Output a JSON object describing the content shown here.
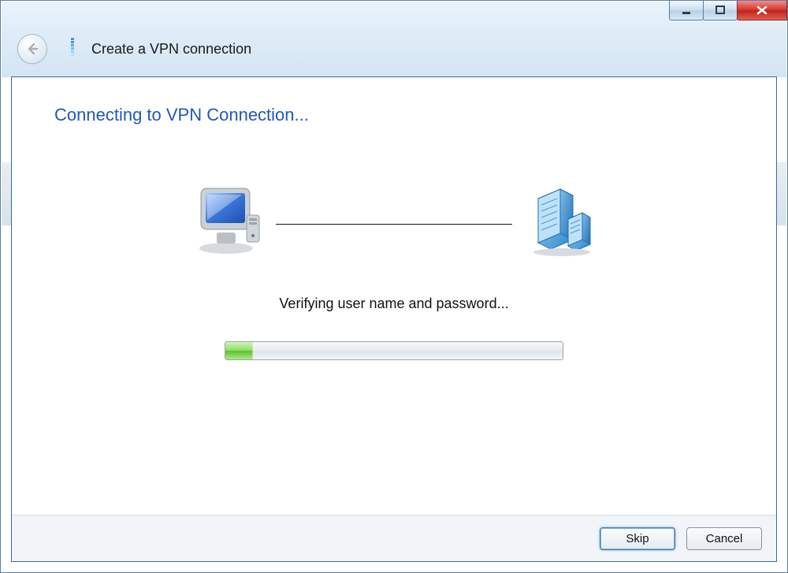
{
  "window": {
    "title": "Create a VPN connection"
  },
  "page": {
    "heading": "Connecting to VPN Connection...",
    "status": "Verifying user name and password...",
    "progress_percent": 8
  },
  "buttons": {
    "skip": "Skip",
    "cancel": "Cancel"
  },
  "controls": {
    "minimize": "Minimize",
    "maximize": "Maximize",
    "close": "Close",
    "back": "Back"
  },
  "icons": {
    "back": "back-arrow-icon",
    "wizard": "network-wizard-icon",
    "client": "computer-icon",
    "server": "server-icon"
  }
}
